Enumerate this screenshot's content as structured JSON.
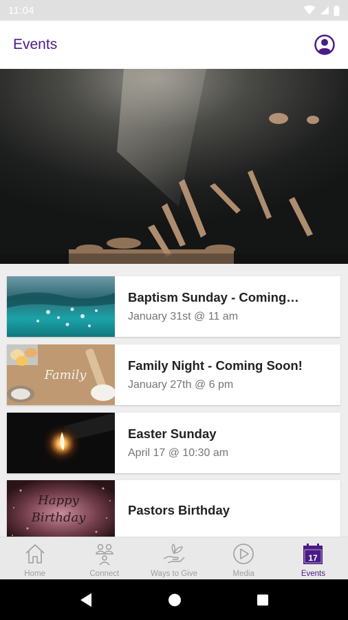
{
  "status_bar": {
    "time": "11:04"
  },
  "app_bar": {
    "title": "Events"
  },
  "events": [
    {
      "title": "Baptism Sunday - Coming…",
      "date": "January 31st @ 11 am"
    },
    {
      "title": "Family Night - Coming Soon!",
      "date": "January 27th @ 6 pm"
    },
    {
      "title": "Easter Sunday",
      "date": "April 17 @ 10:30 am"
    },
    {
      "title": "Pastors Birthday",
      "date": ""
    }
  ],
  "thumbnails": {
    "family_text": "Family",
    "birthday_line1": "Happy",
    "birthday_line2": "Birthday"
  },
  "tabs": [
    {
      "label": "Home",
      "icon": "home-icon",
      "active": false
    },
    {
      "label": "Connect",
      "icon": "connect-icon",
      "active": false
    },
    {
      "label": "Ways to Give",
      "icon": "give-icon",
      "active": false
    },
    {
      "label": "Media",
      "icon": "media-play-icon",
      "active": false
    },
    {
      "label": "Events",
      "icon": "calendar-icon",
      "active": true
    }
  ],
  "calendar_day": "17",
  "colors": {
    "accent": "#4a1a86",
    "inactive": "#9e9e9e"
  }
}
